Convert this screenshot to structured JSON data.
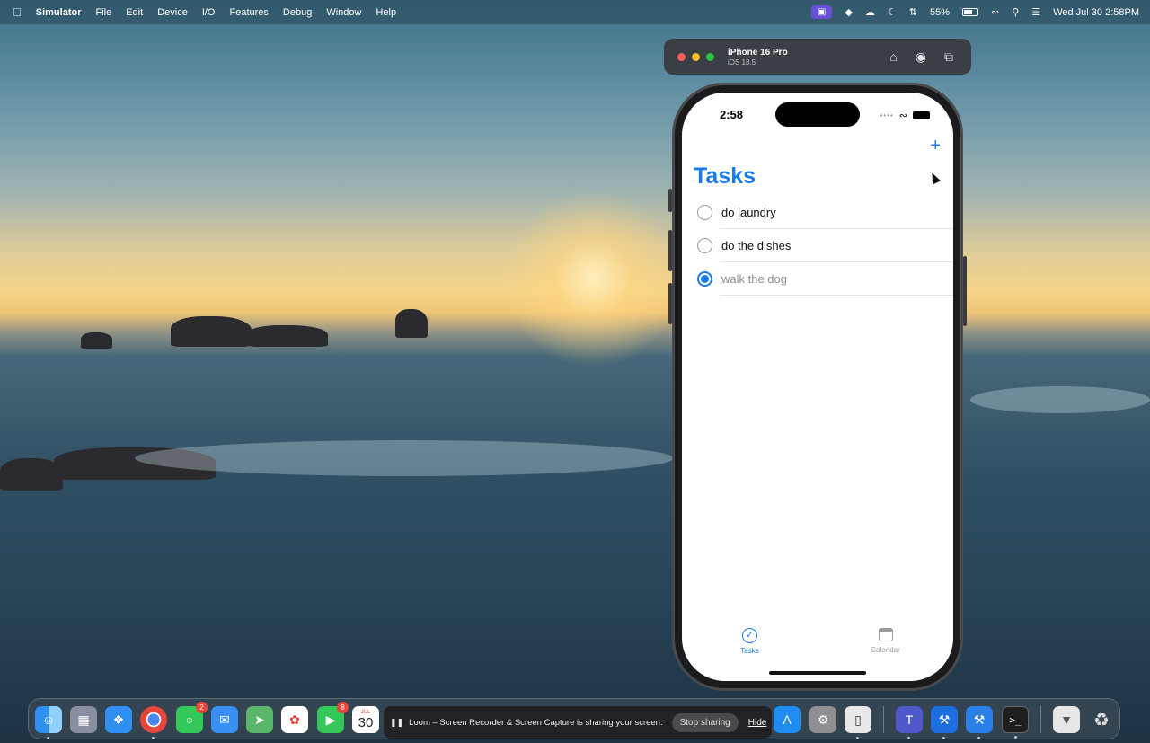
{
  "menubar": {
    "app_name": "Simulator",
    "items": [
      "File",
      "Edit",
      "Device",
      "I/O",
      "Features",
      "Debug",
      "Window",
      "Help"
    ],
    "battery_percent": "55%",
    "datetime": "Wed Jul 30  2:58PM"
  },
  "simulator": {
    "device_name": "iPhone 16 Pro",
    "os_version": "iOS 18.5"
  },
  "phone": {
    "status_time": "2:58",
    "title": "Tasks",
    "add_symbol": "+",
    "tasks": [
      {
        "label": "do laundry",
        "completed": false
      },
      {
        "label": "do the dishes",
        "completed": false
      },
      {
        "label": "walk the dog",
        "completed": true
      }
    ],
    "tabs": [
      {
        "label": "Tasks",
        "icon": "checkmark-circle-icon",
        "active": true
      },
      {
        "label": "Calendar",
        "icon": "calendar-icon",
        "active": false
      }
    ],
    "accent_color": "#1a7be8"
  },
  "dock": {
    "messages_badge": "2",
    "facetime_badge": "8",
    "calendar_month": "JUL",
    "calendar_day": "30",
    "share_message": "Loom – Screen Recorder & Screen Capture is sharing your screen.",
    "stop_sharing_label": "Stop sharing",
    "hide_label": "Hide"
  }
}
